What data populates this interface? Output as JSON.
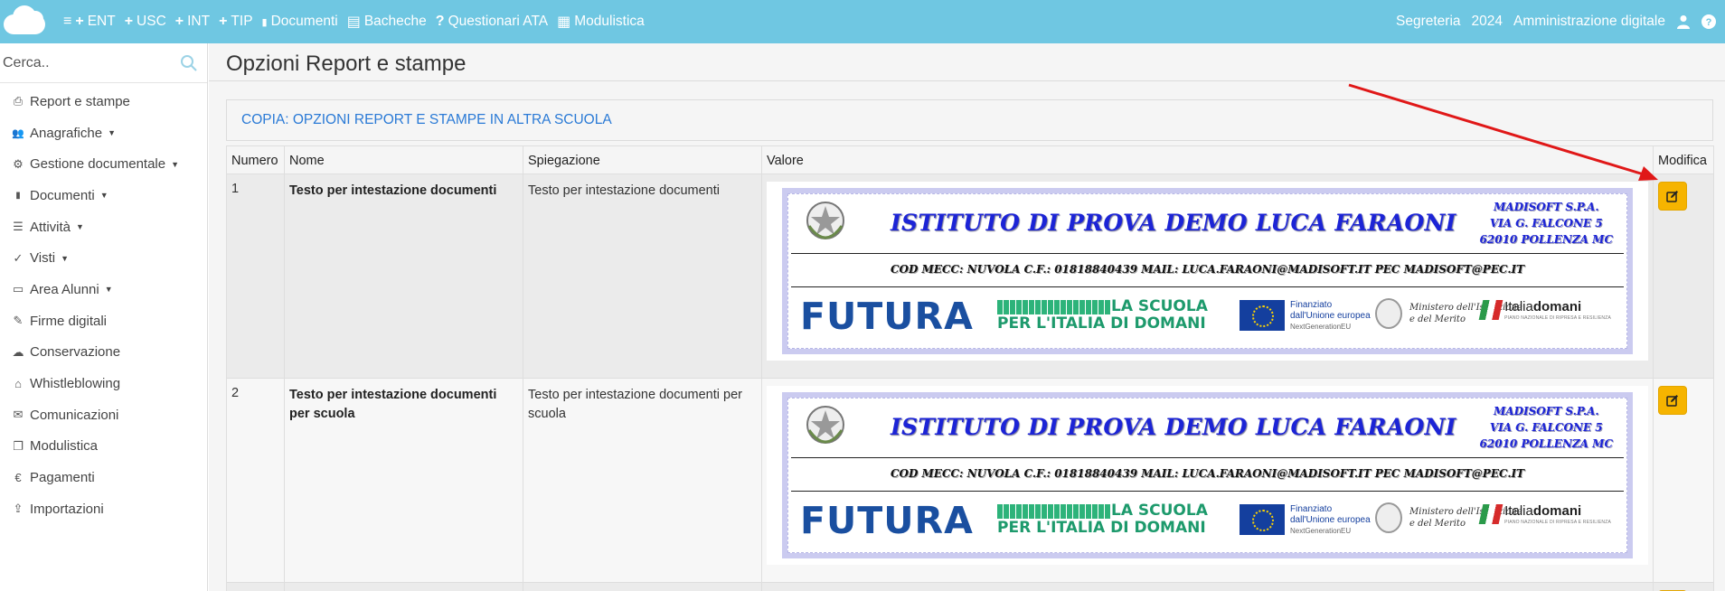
{
  "topbar": {
    "nav": [
      {
        "icon": "menu-icon",
        "glyph": "≡",
        "label": "ENT",
        "prefix": "+"
      },
      {
        "icon": "plus-icon",
        "glyph": "+",
        "label": "USC"
      },
      {
        "icon": "plus-icon",
        "glyph": "+",
        "label": "INT"
      },
      {
        "icon": "plus-icon",
        "glyph": "+",
        "label": "TIP"
      },
      {
        "icon": "file-icon",
        "glyph": "▮",
        "label": "Documenti"
      },
      {
        "icon": "board-icon",
        "glyph": "▤",
        "label": "Bacheche"
      },
      {
        "icon": "question-icon",
        "glyph": "?",
        "label": "Questionari ATA"
      },
      {
        "icon": "forms-icon",
        "glyph": "▦",
        "label": "Modulistica"
      }
    ],
    "right": {
      "office": "Segreteria",
      "year": "2024",
      "section": "Amministrazione digitale"
    }
  },
  "sidebar": {
    "search_placeholder": "Cerca..",
    "items": [
      {
        "label": "Report e stampe",
        "icon": "printer-icon",
        "glyph": "⎙",
        "caret": false
      },
      {
        "label": "Anagrafiche",
        "icon": "users-icon",
        "glyph": "👥",
        "caret": true
      },
      {
        "label": "Gestione documentale",
        "icon": "cogs-icon",
        "glyph": "⚙",
        "caret": true
      },
      {
        "label": "Documenti",
        "icon": "file-icon",
        "glyph": "▮",
        "caret": true
      },
      {
        "label": "Attività",
        "icon": "list-icon",
        "glyph": "☰",
        "caret": true
      },
      {
        "label": "Visti",
        "icon": "check-icon",
        "glyph": "✓",
        "caret": true
      },
      {
        "label": "Area Alunni",
        "icon": "folder-icon",
        "glyph": "▭",
        "caret": true
      },
      {
        "label": "Firme digitali",
        "icon": "pencil-icon",
        "glyph": "✎",
        "caret": false
      },
      {
        "label": "Conservazione",
        "icon": "cloud-upload-icon",
        "glyph": "☁",
        "caret": false
      },
      {
        "label": "Whistleblowing",
        "icon": "building-icon",
        "glyph": "⌂",
        "caret": false
      },
      {
        "label": "Comunicazioni",
        "icon": "envelope-icon",
        "glyph": "✉",
        "caret": false
      },
      {
        "label": "Modulistica",
        "icon": "copy-icon",
        "glyph": "❐",
        "caret": false
      },
      {
        "label": "Pagamenti",
        "icon": "euro-icon",
        "glyph": "€",
        "caret": false
      },
      {
        "label": "Importazioni",
        "icon": "upload-icon",
        "glyph": "⇪",
        "caret": false
      }
    ],
    "caret_glyph": "▼"
  },
  "main": {
    "title": "Opzioni Report e stampe",
    "copy_link": "COPIA: OPZIONI REPORT E STAMPE IN ALTRA SCUOLA",
    "table": {
      "headers": {
        "numero": "Numero",
        "nome": "Nome",
        "spiegazione": "Spiegazione",
        "valore": "Valore",
        "modifica": "Modifica"
      },
      "rows": [
        {
          "numero": "1",
          "nome": "Testo per intestazione documenti",
          "spiegazione": "Testo per intestazione documenti"
        },
        {
          "numero": "2",
          "nome": "Testo per intestazione documenti per scuola",
          "spiegazione": "Testo per intestazione documenti per scuola"
        }
      ]
    },
    "letterhead": {
      "school_name": "ISTITUTO DI PROVA DEMO LUCA FARAONI",
      "address": [
        "MADISOFT S.P.A.",
        "VIA G. FALCONE 5",
        "62010 POLLENZA MC"
      ],
      "codes": "COD MECC: NUVOLA   C.F.: 01818840439  MAIL: LUCA.FARAONI@MADISOFT.IT  PEC MADISOFT@PEC.IT",
      "futura": "FUTURA",
      "scuola_line1": "LA SCUOLA",
      "scuola_line2": "PER L'ITALIA DI DOMANI",
      "eu_line1": "Finanziato",
      "eu_line2": "dall'Unione europea",
      "eu_line3": "NextGenerationEU",
      "ministero_line1": "Ministero dell'Istruzione",
      "ministero_line2": "e del Merito",
      "italia": "Italia",
      "domani": "domani",
      "italia_small": "PIANO NAZIONALE DI RIPRESA E RESILIENZA"
    },
    "colors": {
      "topbar": "#6fc7e2",
      "edit_button": "#f6b400",
      "link": "#2a7ad6",
      "annotation_arrow": "#e01818"
    }
  }
}
